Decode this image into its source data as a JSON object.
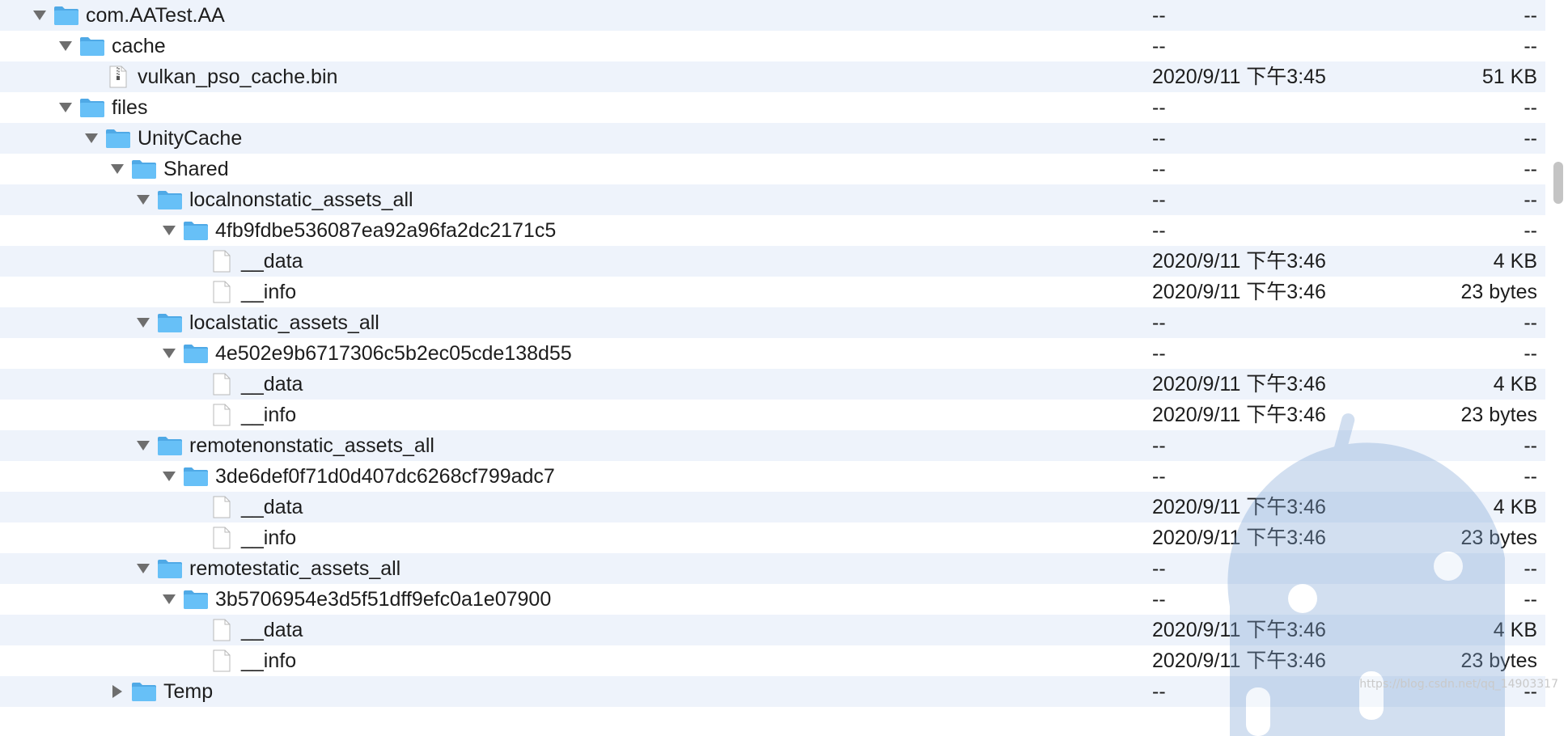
{
  "rows": [
    {
      "depth": 0,
      "type": "folder",
      "expanded": true,
      "name": "com.AATest.AA",
      "date": "--",
      "size": "--"
    },
    {
      "depth": 1,
      "type": "folder",
      "expanded": true,
      "name": "cache",
      "date": "--",
      "size": "--"
    },
    {
      "depth": 2,
      "type": "file",
      "file_kind": "archive",
      "name": "vulkan_pso_cache.bin",
      "date": "2020/9/11 下午3:45",
      "size": "51 KB"
    },
    {
      "depth": 1,
      "type": "folder",
      "expanded": true,
      "name": "files",
      "date": "--",
      "size": "--"
    },
    {
      "depth": 2,
      "type": "folder",
      "expanded": true,
      "name": "UnityCache",
      "date": "--",
      "size": "--"
    },
    {
      "depth": 3,
      "type": "folder",
      "expanded": true,
      "name": "Shared",
      "date": "--",
      "size": "--"
    },
    {
      "depth": 4,
      "type": "folder",
      "expanded": true,
      "name": "localnonstatic_assets_all",
      "date": "--",
      "size": "--"
    },
    {
      "depth": 5,
      "type": "folder",
      "expanded": true,
      "name": "4fb9fdbe536087ea92a96fa2dc2171c5",
      "date": "--",
      "size": "--"
    },
    {
      "depth": 6,
      "type": "file",
      "file_kind": "blank",
      "name": "__data",
      "date": "2020/9/11 下午3:46",
      "size": "4 KB"
    },
    {
      "depth": 6,
      "type": "file",
      "file_kind": "blank",
      "name": "__info",
      "date": "2020/9/11 下午3:46",
      "size": "23 bytes"
    },
    {
      "depth": 4,
      "type": "folder",
      "expanded": true,
      "name": "localstatic_assets_all",
      "date": "--",
      "size": "--"
    },
    {
      "depth": 5,
      "type": "folder",
      "expanded": true,
      "name": "4e502e9b6717306c5b2ec05cde138d55",
      "date": "--",
      "size": "--"
    },
    {
      "depth": 6,
      "type": "file",
      "file_kind": "blank",
      "name": "__data",
      "date": "2020/9/11 下午3:46",
      "size": "4 KB"
    },
    {
      "depth": 6,
      "type": "file",
      "file_kind": "blank",
      "name": "__info",
      "date": "2020/9/11 下午3:46",
      "size": "23 bytes"
    },
    {
      "depth": 4,
      "type": "folder",
      "expanded": true,
      "name": "remotenonstatic_assets_all",
      "date": "--",
      "size": "--"
    },
    {
      "depth": 5,
      "type": "folder",
      "expanded": true,
      "name": "3de6def0f71d0d407dc6268cf799adc7",
      "date": "--",
      "size": "--"
    },
    {
      "depth": 6,
      "type": "file",
      "file_kind": "blank",
      "name": "__data",
      "date": "2020/9/11 下午3:46",
      "size": "4 KB"
    },
    {
      "depth": 6,
      "type": "file",
      "file_kind": "blank",
      "name": "__info",
      "date": "2020/9/11 下午3:46",
      "size": "23 bytes"
    },
    {
      "depth": 4,
      "type": "folder",
      "expanded": true,
      "name": "remotestatic_assets_all",
      "date": "--",
      "size": "--"
    },
    {
      "depth": 5,
      "type": "folder",
      "expanded": true,
      "name": "3b5706954e3d5f51dff9efc0a1e07900",
      "date": "--",
      "size": "--"
    },
    {
      "depth": 6,
      "type": "file",
      "file_kind": "blank",
      "name": "__data",
      "date": "2020/9/11 下午3:46",
      "size": "4 KB"
    },
    {
      "depth": 6,
      "type": "file",
      "file_kind": "blank",
      "name": "__info",
      "date": "2020/9/11 下午3:46",
      "size": "23 bytes"
    },
    {
      "depth": 3,
      "type": "folder",
      "expanded": false,
      "name": "Temp",
      "date": "--",
      "size": "--"
    }
  ],
  "colors": {
    "row_alt": "#eef3fb",
    "folder_blue": "#67c0f7",
    "folder_tab": "#4fa9e6",
    "disclosure": "#6e6e6e",
    "watermark": "#7fa6d6"
  },
  "icons": {
    "folder": "folder-icon",
    "file": "file-icon",
    "archive": "archive-file-icon",
    "expanded": "disclosure-down-icon",
    "collapsed": "disclosure-right-icon"
  },
  "watermark_text": "https://blog.csdn.net/qq_14903317"
}
